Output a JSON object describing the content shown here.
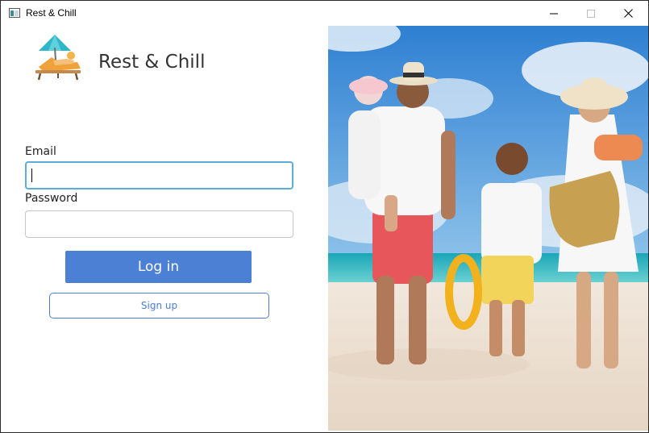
{
  "window": {
    "title": "Rest & Chill",
    "controls": {
      "minimize_icon": "minimize-icon",
      "maximize_icon": "maximize-icon",
      "close_icon": "close-icon"
    }
  },
  "brand": {
    "name": "Rest & Chill",
    "logo_icon": "beach-umbrella-lounger-icon"
  },
  "form": {
    "email": {
      "label": "Email",
      "value": "",
      "placeholder": ""
    },
    "password": {
      "label": "Password",
      "value": "",
      "placeholder": ""
    },
    "login_label": "Log in",
    "signup_label": "Sign up"
  },
  "colors": {
    "accent": "#4b80d4",
    "focus_border": "#5aaed8"
  },
  "hero_image": "family-walking-on-beach-photo"
}
